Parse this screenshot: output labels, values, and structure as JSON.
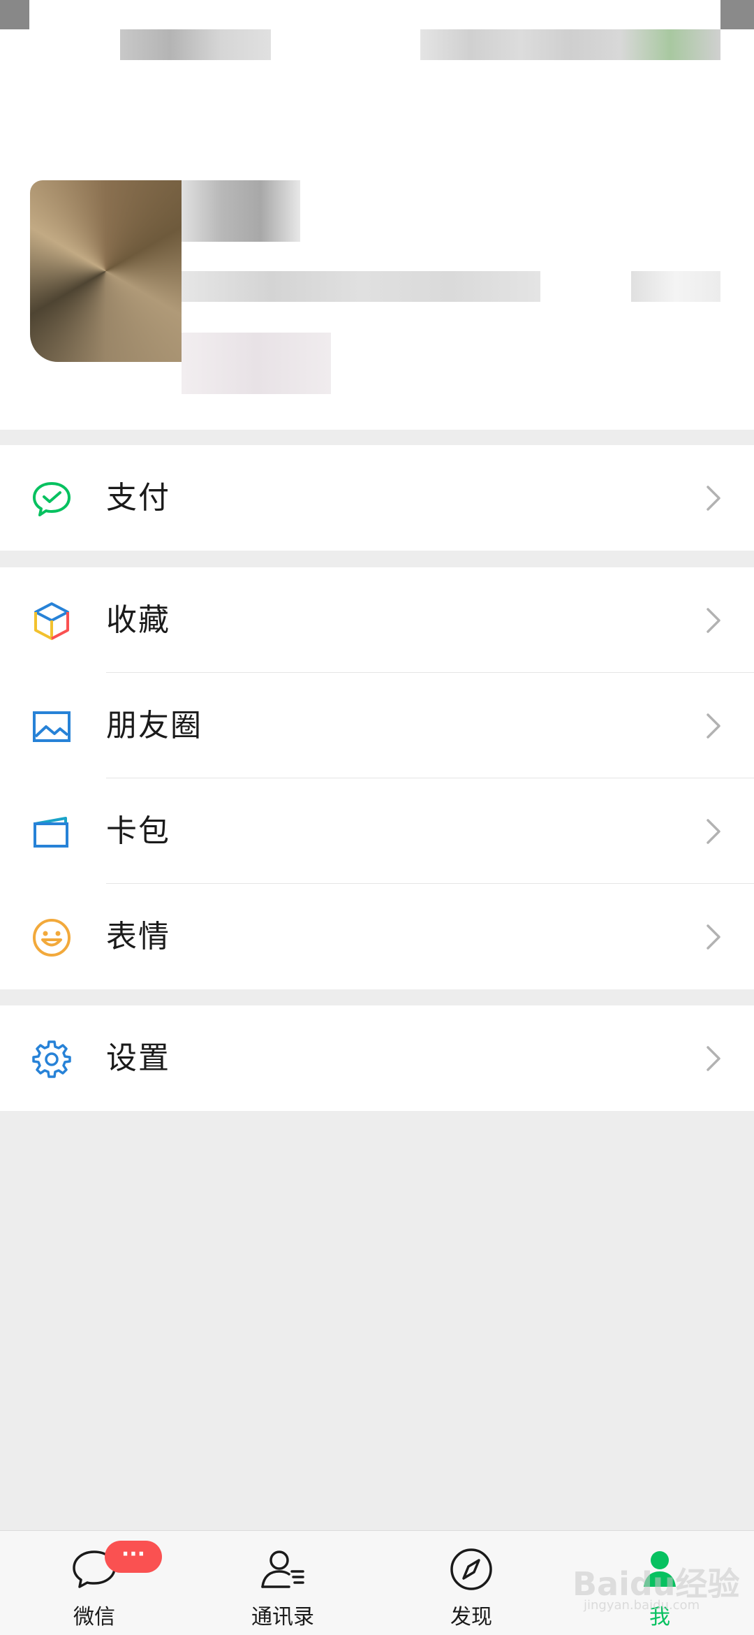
{
  "menu": {
    "pay": {
      "label": "支付",
      "icon": "pay-icon",
      "color": "#07c160"
    },
    "favorites": {
      "label": "收藏",
      "icon": "cube-icon"
    },
    "moments": {
      "label": "朋友圈",
      "icon": "image-icon",
      "color": "#2782d7"
    },
    "cards": {
      "label": "卡包",
      "icon": "card-icon",
      "color": "#1aa3c8"
    },
    "stickers": {
      "label": "表情",
      "icon": "smile-icon",
      "color": "#f2a93b"
    },
    "settings": {
      "label": "设置",
      "icon": "gear-icon",
      "color": "#2782d7"
    }
  },
  "tabbar": {
    "chats": {
      "label": "微信",
      "badge": "···"
    },
    "contacts": {
      "label": "通讯录"
    },
    "discover": {
      "label": "发现"
    },
    "me": {
      "label": "我",
      "active": true,
      "color": "#07c160"
    }
  },
  "watermark": {
    "brand": "Baidu经验",
    "url": "jingyan.baidu.com"
  }
}
